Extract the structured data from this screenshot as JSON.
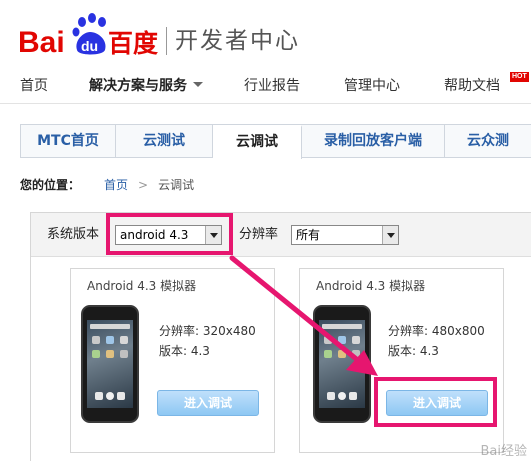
{
  "brand": {
    "logo_text_left": "Bai",
    "logo_paw_text": "du",
    "logo_text_right": "百度",
    "subtitle": "开发者中心",
    "colors": {
      "red": "#e10602",
      "blue": "#2932e1",
      "accent": "#e6166f"
    }
  },
  "nav": {
    "items": [
      {
        "label": "首页"
      },
      {
        "label": "解决方案与服务"
      },
      {
        "label": "行业报告"
      },
      {
        "label": "管理中心"
      },
      {
        "label": "帮助文档"
      }
    ],
    "hot_badge": "HOT"
  },
  "tabs": [
    {
      "label": "MTC首页"
    },
    {
      "label": "云测试"
    },
    {
      "label": "云调试"
    },
    {
      "label": "录制回放客户端"
    },
    {
      "label": "云众测"
    }
  ],
  "breadcrumb": {
    "label": "您的位置：",
    "home": "首页",
    "separator": ">",
    "current": "云调试"
  },
  "filters": {
    "version_label": "系统版本",
    "version_value": "android 4.3",
    "resolution_label": "分辨率",
    "resolution_value": "所有"
  },
  "emulators": [
    {
      "title": "Android 4.3 模拟器",
      "resolution": "分辨率: 320x480",
      "version": "版本: 4.3",
      "button": "进入调试"
    },
    {
      "title": "Android 4.3 模拟器",
      "resolution": "分辨率: 480x800",
      "version": "版本: 4.3",
      "button": "进入调试"
    }
  ],
  "watermark": "Bai经验"
}
